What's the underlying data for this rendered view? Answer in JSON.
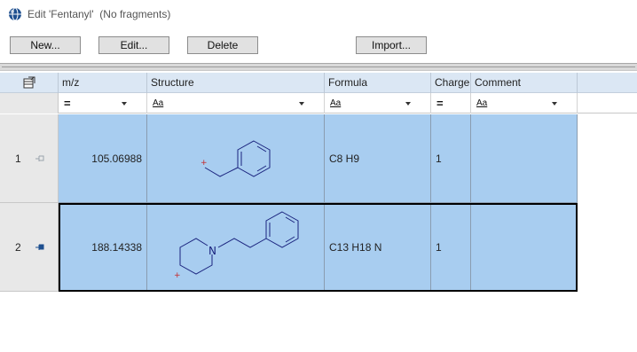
{
  "window": {
    "title": "Edit 'Fentanyl'  (No fragments)",
    "icon": "app-globe-icon"
  },
  "toolbar": {
    "new_label": "New...",
    "edit_label": "Edit...",
    "delete_label": "Delete",
    "import_label": "Import..."
  },
  "grid": {
    "corner_icon": "column-chooser-icon",
    "headers": [
      "m/z",
      "Structure",
      "Formula",
      "Charge",
      "Comment"
    ],
    "filters": [
      "=",
      "Aa",
      "Aa",
      "=",
      "Aa"
    ],
    "rows": [
      {
        "index": "1",
        "mz": "105.06988",
        "structure": "benzyl-cation",
        "formula": "C8 H9",
        "charge": "1",
        "comment": "",
        "pinned": false
      },
      {
        "index": "2",
        "mz": "188.14338",
        "structure": "phenethylpiperidinyl-cation",
        "formula": "C13 H18 N",
        "charge": "1",
        "comment": "",
        "pinned": true
      }
    ],
    "structure_labels": {
      "nitrogen": "N",
      "charge_mark": "+"
    }
  },
  "colors": {
    "row_selected_bg": "#a8cdf0",
    "header_bg": "#dbe7f4",
    "bond_color": "#1a237e",
    "charge_color": "#c62828"
  }
}
